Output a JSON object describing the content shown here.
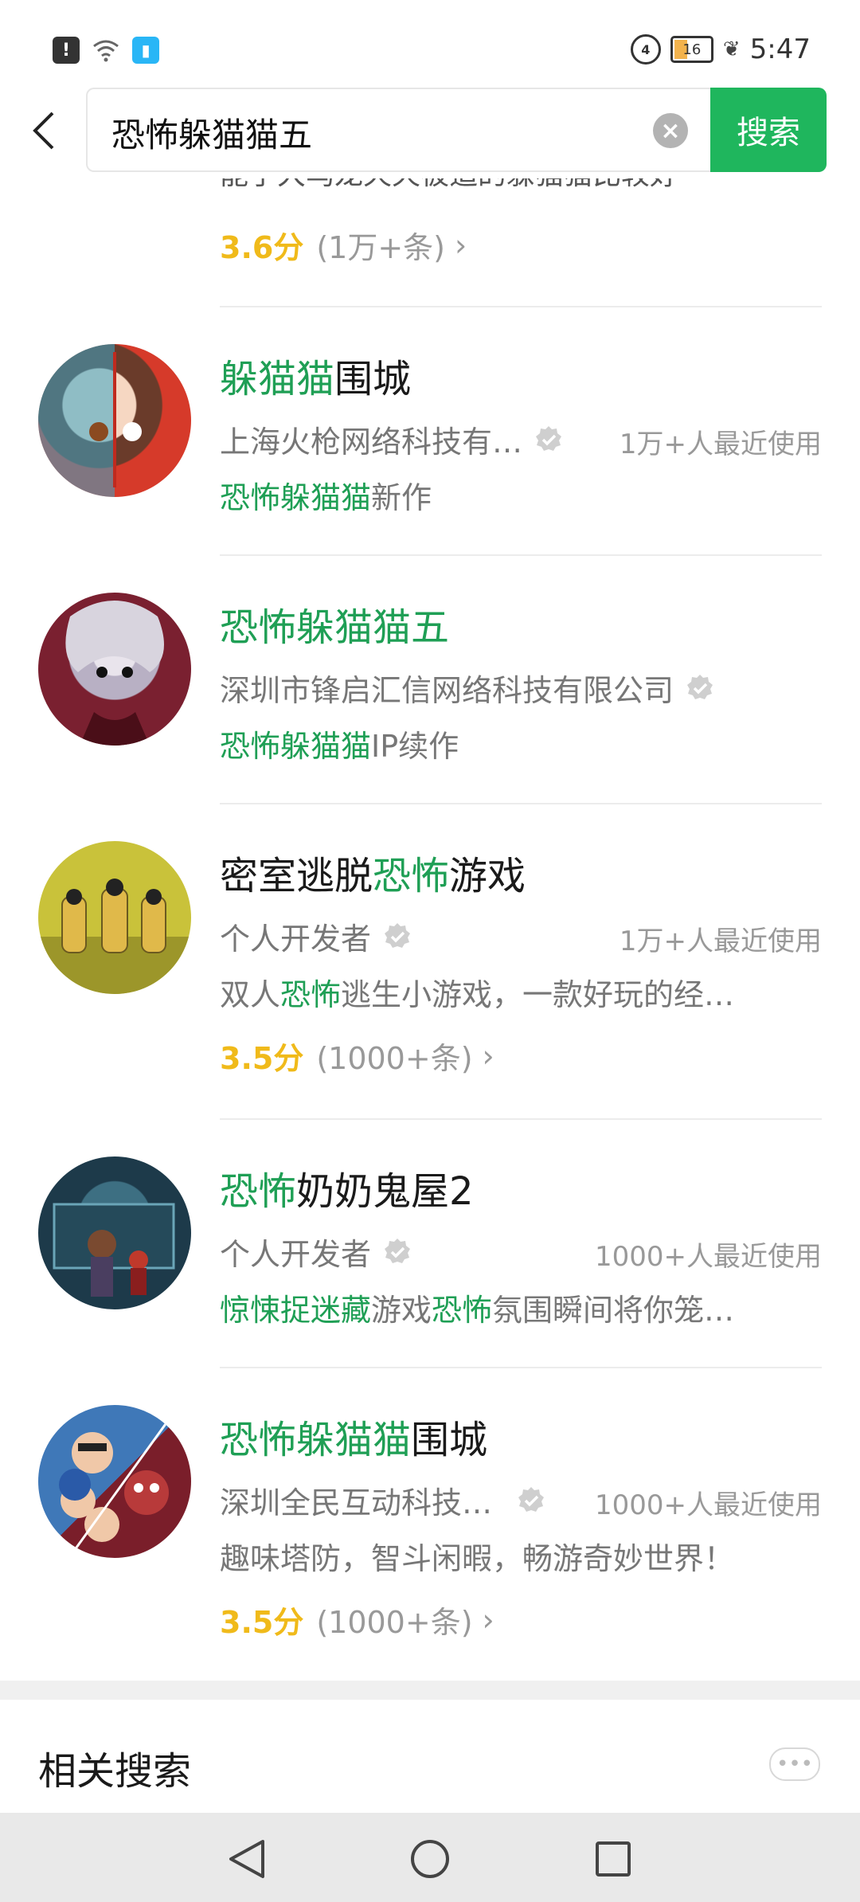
{
  "status_bar": {
    "time": "5:47",
    "battery": "16"
  },
  "search": {
    "query": "恐怖躲猫猫五",
    "button_label": "搜索"
  },
  "partial_item": {
    "desc_fragment": "能了大乌龙天天被追的躲猫猫比较好",
    "rating": {
      "score": "3.6分",
      "count": "(1万+条)"
    }
  },
  "results": [
    {
      "title_hl": "躲猫猫",
      "title_rest": "围城",
      "developer": "上海火枪网络科技有…",
      "users": "1万+人最近使用",
      "desc_hl": "恐怖躲猫猫",
      "desc_rest": "新作"
    },
    {
      "title_hl": "恐怖躲猫猫五",
      "title_rest": "",
      "developer": "深圳市锋启汇信网络科技有限公司",
      "users": "",
      "desc_hl": "恐怖躲猫猫",
      "desc_rest": "IP续作"
    },
    {
      "title_pre": "密室逃脱",
      "title_hl": "恐怖",
      "title_rest": "游戏",
      "developer": "个人开发者",
      "users": "1万+人最近使用",
      "desc_pre": "双人",
      "desc_hl": "恐怖",
      "desc_rest": "逃生小游戏，一款好玩的经…",
      "rating": {
        "score": "3.5分",
        "count": "(1000+条)"
      }
    },
    {
      "title_hl": "恐怖",
      "title_rest": "奶奶鬼屋2",
      "developer": "个人开发者",
      "users": "1000+人最近使用",
      "desc_hl": "惊悚捉迷藏",
      "desc_mid": "游戏",
      "desc_hl2": "恐怖",
      "desc_rest": "氛围瞬间将你笼…"
    },
    {
      "title_hl": "恐怖躲猫猫",
      "title_rest": "围城",
      "developer": "深圳全民互动科技…",
      "users": "1000+人最近使用",
      "desc_rest": "趣味塔防，智斗闲暇，畅游奇妙世界！",
      "rating": {
        "score": "3.5分",
        "count": "(1000+条)"
      }
    }
  ],
  "related": {
    "title": "相关搜索"
  },
  "colors": {
    "accent": "#1fb65d",
    "highlight": "#1f9f55",
    "rating": "#f0ba1a"
  },
  "icons": [
    "back-arrow-icon",
    "clear-icon",
    "verified-icon",
    "chevron-right-icon",
    "more-icon",
    "nav-back-icon",
    "nav-home-icon",
    "nav-recents-icon"
  ]
}
